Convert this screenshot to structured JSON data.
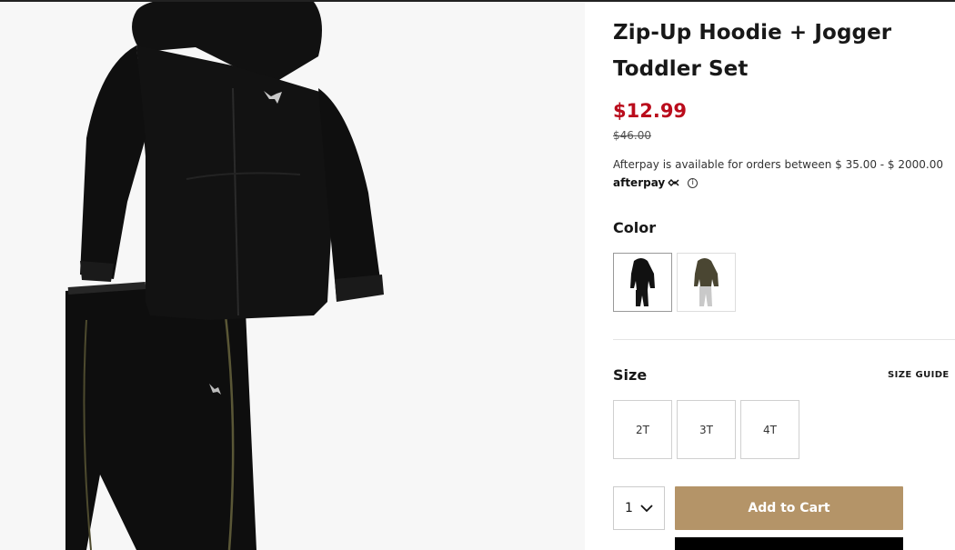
{
  "product": {
    "title": "Zip-Up Hoodie + Jogger Toddler Set",
    "sale_price": "$12.99",
    "original_price": "$46.00"
  },
  "afterpay": {
    "text": "Afterpay is available for orders between $ 35.00 - $ 2000.00",
    "logo": "afterpay",
    "info_icon": "ⓘ"
  },
  "color": {
    "label": "Color",
    "swatches": [
      {
        "name": "Black",
        "selected": true
      },
      {
        "name": "Olive / Grey",
        "selected": false
      }
    ]
  },
  "size": {
    "label": "Size",
    "guide_label": "SIZE GUIDE",
    "options": [
      "2T",
      "3T",
      "4T"
    ]
  },
  "purchase": {
    "quantity": "1",
    "add_to_cart": "Add to Cart"
  },
  "colors": {
    "sale": "#ba0c1c",
    "cart_button": "#b49468",
    "product_black": "#0d0d0d"
  }
}
